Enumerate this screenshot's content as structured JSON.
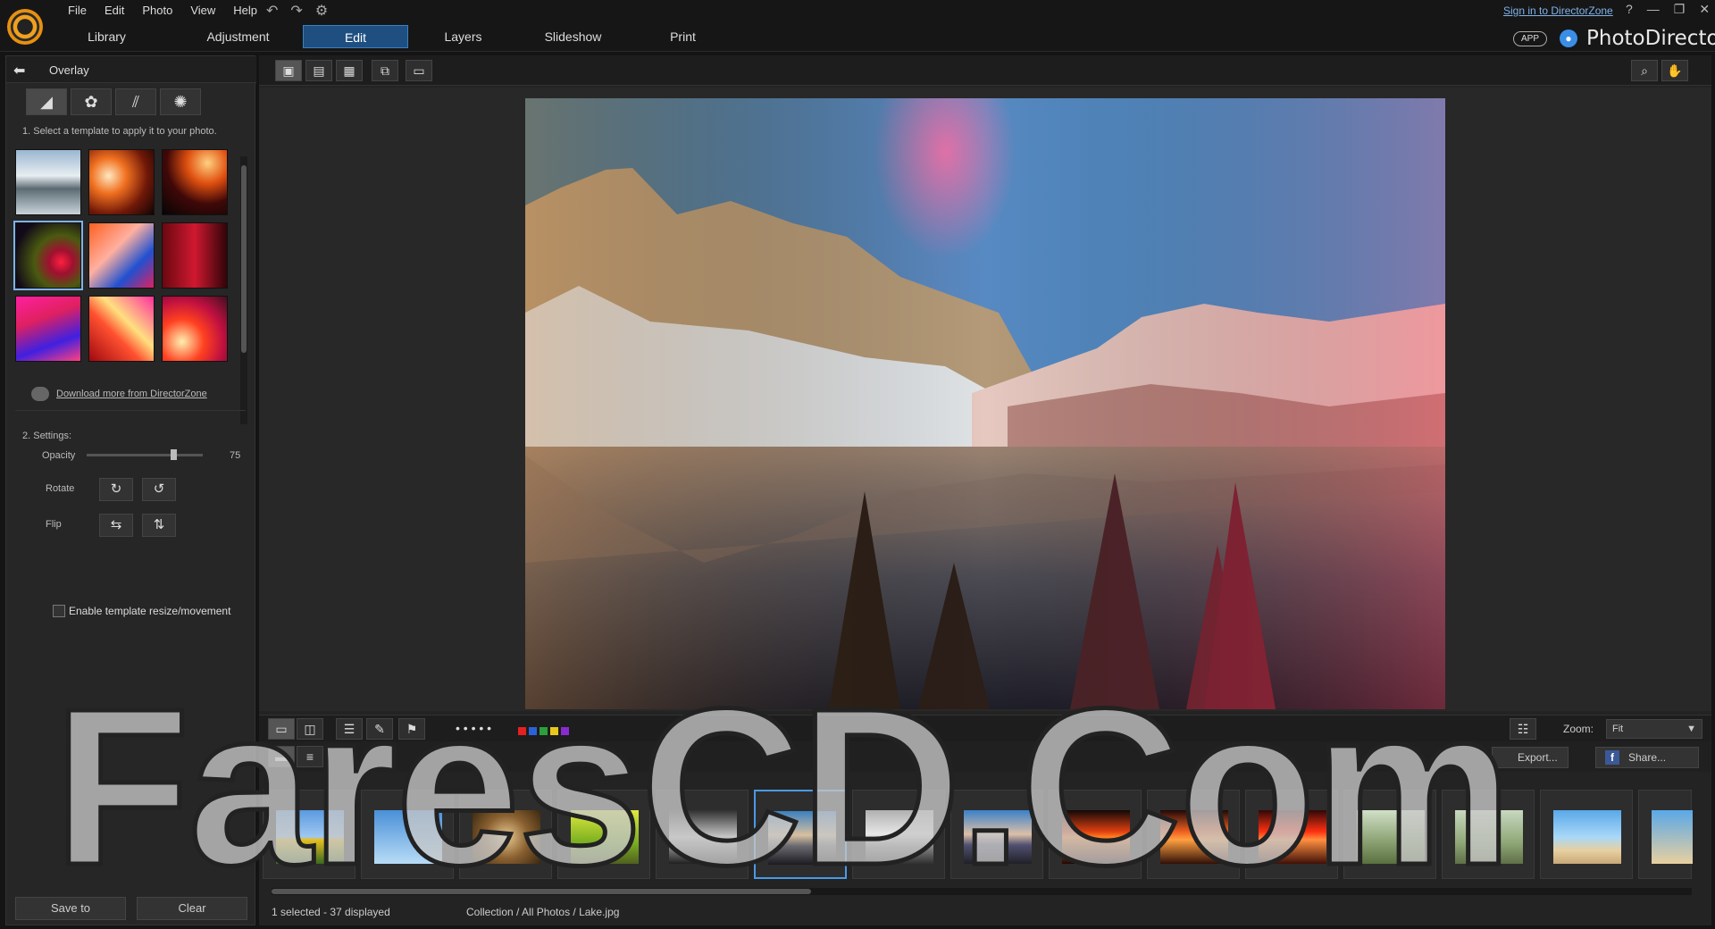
{
  "menu": [
    "File",
    "Edit",
    "Photo",
    "View",
    "Help"
  ],
  "tabs": [
    {
      "label": "Library",
      "active": false
    },
    {
      "label": "Adjustment",
      "active": false
    },
    {
      "label": "Edit",
      "active": true
    },
    {
      "label": "Layers",
      "active": false
    },
    {
      "label": "Slideshow",
      "active": false
    },
    {
      "label": "Print",
      "active": false
    }
  ],
  "signin": "Sign in to DirectorZone",
  "app_badge": "APP",
  "brand": "PhotoDirector",
  "panel": {
    "title": "Overlay",
    "step1": "1. Select a template to apply it to your photo.",
    "download": "Download more from DirectorZone",
    "step2": "2. Settings:",
    "opacity_label": "Opacity",
    "opacity_value": "75",
    "opacity_level": 0.75,
    "rotate_label": "Rotate",
    "flip_label": "Flip",
    "enable_label": "Enable template resize/movement",
    "enable_checked": false,
    "save_label": "Save to",
    "clear_label": "Clear"
  },
  "zoom": {
    "label": "Zoom:",
    "value": "Fit"
  },
  "export_label": "Export...",
  "share_label": "Share...",
  "status": "1 selected - 37 displayed",
  "breadcrumb": "Collection / All Photos / Lake.jpg",
  "color_labels": [
    "#e52020",
    "#2a62d8",
    "#2ba03a",
    "#e8c81a",
    "#8a2ad0"
  ],
  "watermark": "FaresCD.Com"
}
